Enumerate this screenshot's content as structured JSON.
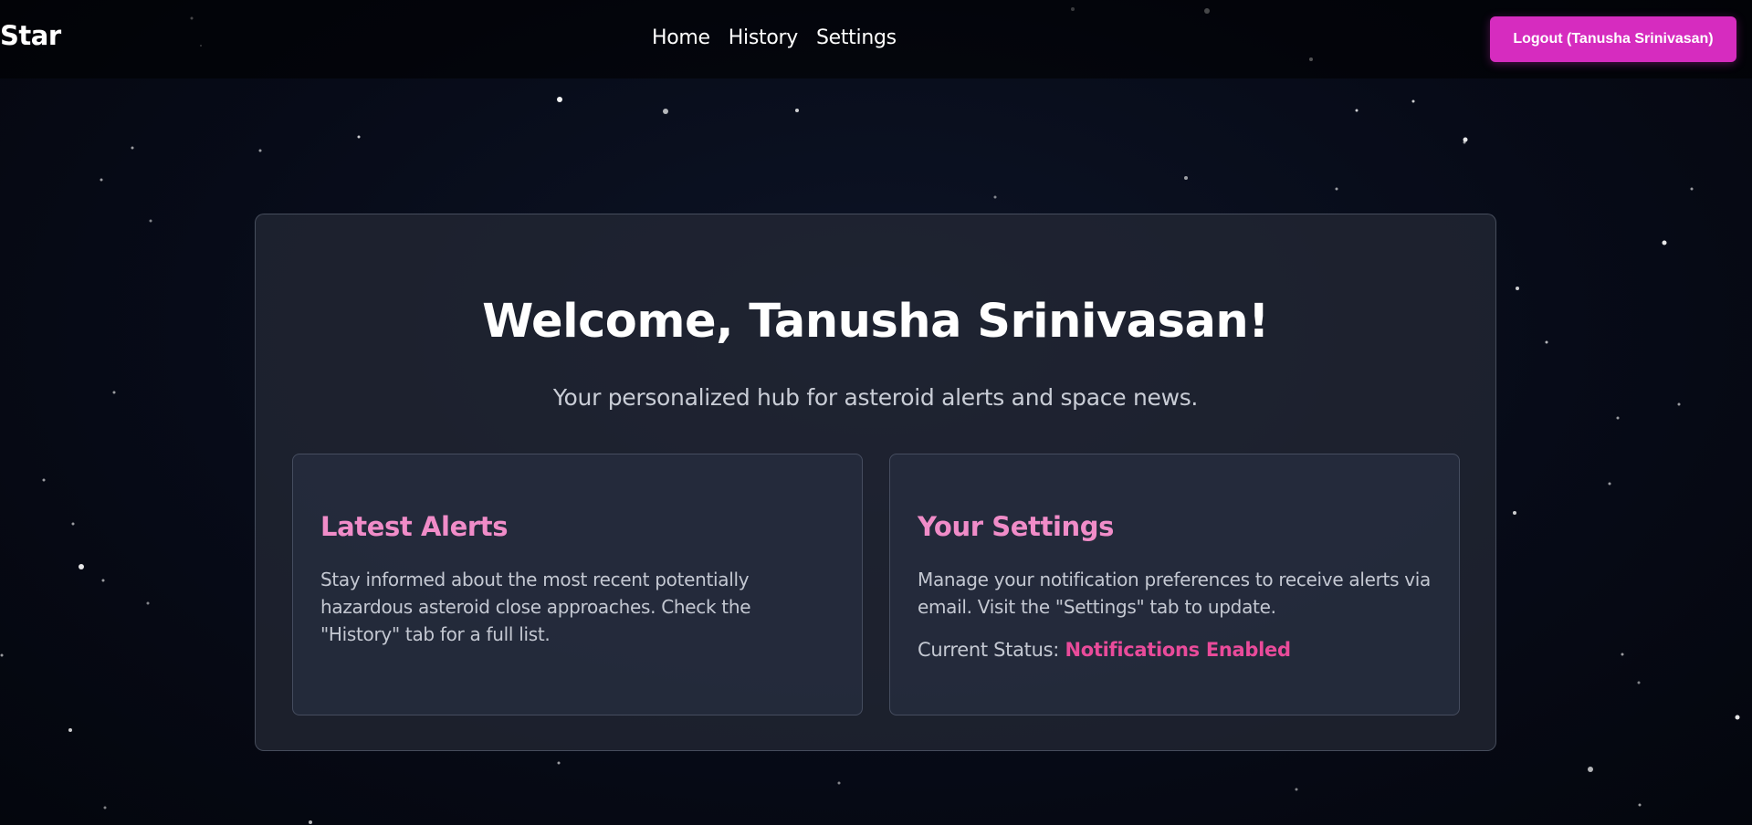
{
  "brand": "Star",
  "nav": {
    "links": [
      "Home",
      "History",
      "Settings"
    ],
    "logout_label": "Logout (Tanusha Srinivasan)"
  },
  "main": {
    "title": "Welcome, Tanusha Srinivasan!",
    "subtitle": "Your personalized hub for asteroid alerts and space news.",
    "cards": [
      {
        "heading": "Latest Alerts",
        "text": "Stay informed about the most recent potentially hazardous asteroid close approaches. Check the \"History\" tab for a full list."
      },
      {
        "heading": "Your Settings",
        "text": "Manage your notification preferences to receive alerts via email. Visit the \"Settings\" tab to update.",
        "status_label": "Current Status:",
        "status_value": "Notifications Enabled"
      }
    ]
  },
  "colors": {
    "accent": "#d62cbf",
    "heading": "#f08cc8",
    "status": "#e94b9a",
    "background": "#070b18"
  }
}
